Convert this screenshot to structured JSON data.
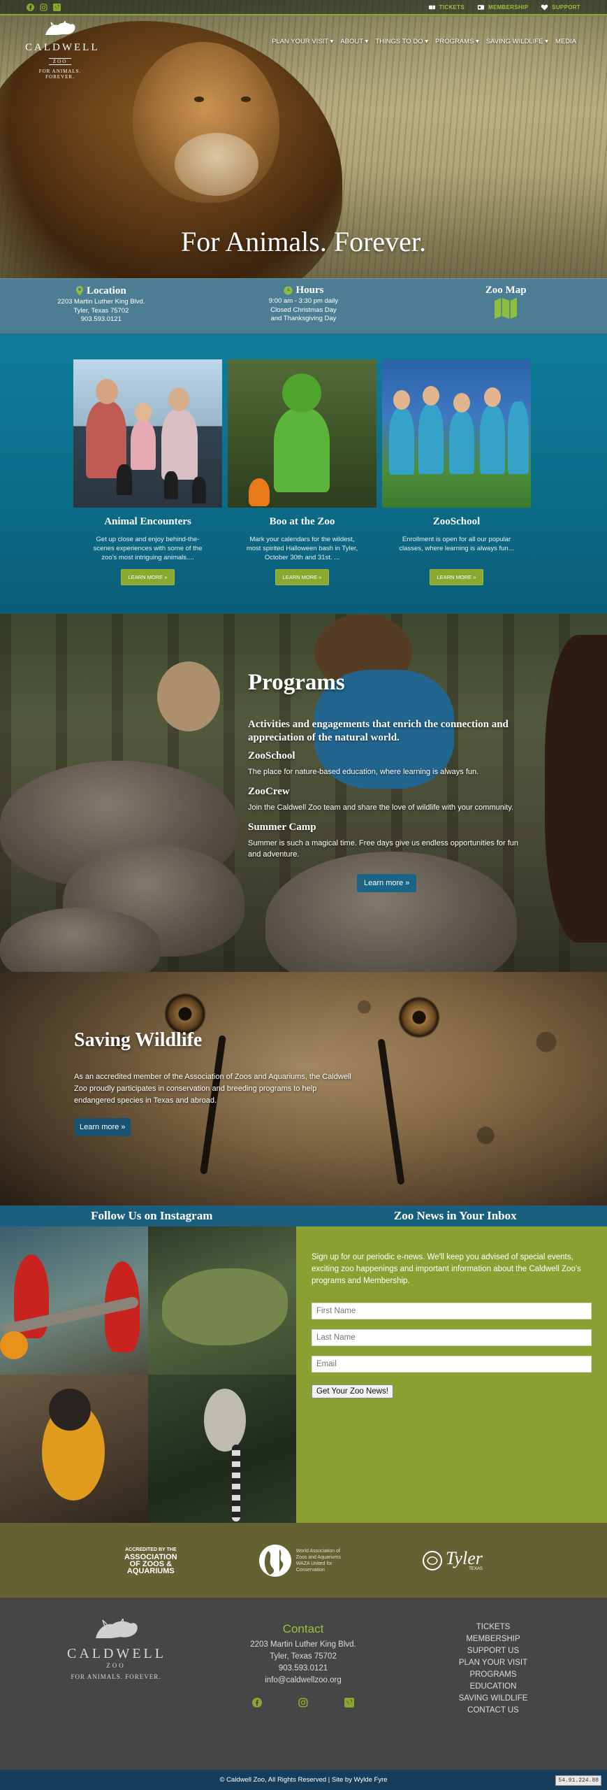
{
  "colors": {
    "brand_green": "#8aa72f",
    "teal": "#0d6f8c",
    "olive": "#646133",
    "footer": "#464646",
    "navy": "#163e5c"
  },
  "topbar": {
    "social_icons": [
      "facebook-icon",
      "instagram-icon",
      "vimeo-icon"
    ],
    "links": [
      {
        "label": "TICKETS",
        "icon": "ticket-icon"
      },
      {
        "label": "MEMBERSHIP",
        "icon": "card-icon"
      },
      {
        "label": "SUPPORT",
        "icon": "heart-icon"
      }
    ]
  },
  "logo": {
    "name": "CALDWELL",
    "zoo": "ZOO",
    "tagline": "FOR ANIMALS. FOREVER."
  },
  "nav": {
    "items": [
      "PLAN YOUR VISIT ▾",
      "ABOUT ▾",
      "THINGS TO DO ▾",
      "PROGRAMS ▾",
      "SAVING WILDLIFE ▾",
      "MEDIA"
    ]
  },
  "hero": {
    "title": "For Animals. Forever."
  },
  "info": {
    "location": {
      "title": "Location",
      "line1": "2203 Martin Luther King Blvd.",
      "line2": "Tyler, Texas 75702",
      "line3": "903.593.0121"
    },
    "hours": {
      "title": "Hours",
      "line1": "9:00 am - 3:30 pm daily",
      "line2": "Closed Christmas Day",
      "line3": "and Thanksgiving Day"
    },
    "map": {
      "title": "Zoo Map"
    }
  },
  "features": [
    {
      "title": "Animal Encounters",
      "text": "Get up close and enjoy behind-the-scenes experiences with some of the zoo's most intriguing animals....",
      "button": "LEARN MORE »"
    },
    {
      "title": "Boo at the Zoo",
      "text": "Mark your calendars for the wildest, most spirited Halloween bash in Tyler, October 30th and 31st. ...",
      "button": "LEARN MORE »"
    },
    {
      "title": "ZooSchool",
      "text": "Enrollment is open for all our popular classes, where learning is always fun...",
      "button": "LEARN MORE »"
    }
  ],
  "programs": {
    "title": "Programs",
    "lead": "Activities and engagements that enrich the connection and appreciation of the natural world.",
    "items": [
      {
        "name": "ZooSchool",
        "text": "The place for nature-based education, where learning is always fun."
      },
      {
        "name": "ZooCrew",
        "text": "Join the Caldwell Zoo team and share the love of wildlife with your community."
      },
      {
        "name": "Summer Camp",
        "text": "Summer is such a magical time. Free days give us endless opportunities for fun and adventure."
      }
    ],
    "button": "Learn more »"
  },
  "saving": {
    "title": "Saving Wildlife",
    "text": "As an accredited member of the Association of Zoos and Aquariums, the Caldwell Zoo proudly participates in conservation and breeding programs to help endangered species in Texas and abroad.",
    "button": "Learn more »"
  },
  "strip": {
    "instagram": "Follow Us on Instagram",
    "news": "Zoo News in Your Inbox"
  },
  "newsletter": {
    "text": "Sign up for our periodic e-news. We'll keep you advised of special events, exciting zoo happenings and important information about the Caldwell Zoo's programs and Membership.",
    "first_name_placeholder": "First Name",
    "last_name_placeholder": "Last Name",
    "email_placeholder": "Email",
    "submit": "Get Your Zoo News!"
  },
  "accreditation": {
    "aza_line1": "ACCREDITED BY THE",
    "aza_line2": "ASSOCIATION",
    "aza_line3": "OF ZOOS &",
    "aza_line4": "AQUARIUMS",
    "waza_line1": "World Association of",
    "waza_line2": "Zoos and Aquariums",
    "waza_line3": "WAZA United for",
    "waza_line4": "Conservation",
    "tyler": "Tyler",
    "tyler_sub": "TEXAS"
  },
  "footer": {
    "logo_name": "CALDWELL",
    "logo_zoo": "ZOO",
    "logo_tagline": "FOR ANIMALS. FOREVER.",
    "contact_title": "Contact",
    "address1": "2203 Martin Luther King Blvd.",
    "address2": "Tyler, Texas 75702",
    "phone": "903.593.0121",
    "email": "info@caldwellzoo.org",
    "links": [
      "TICKETS",
      "MEMBERSHIP",
      "SUPPORT US",
      "PLAN YOUR VISIT",
      "PROGRAMS",
      "EDUCATION",
      "SAVING WILDLIFE",
      "CONTACT US"
    ],
    "copyright": "© Caldwell Zoo, All Rights Reserved | Site by Wylde Fyre",
    "ip_badge": "54.91.224.88"
  }
}
